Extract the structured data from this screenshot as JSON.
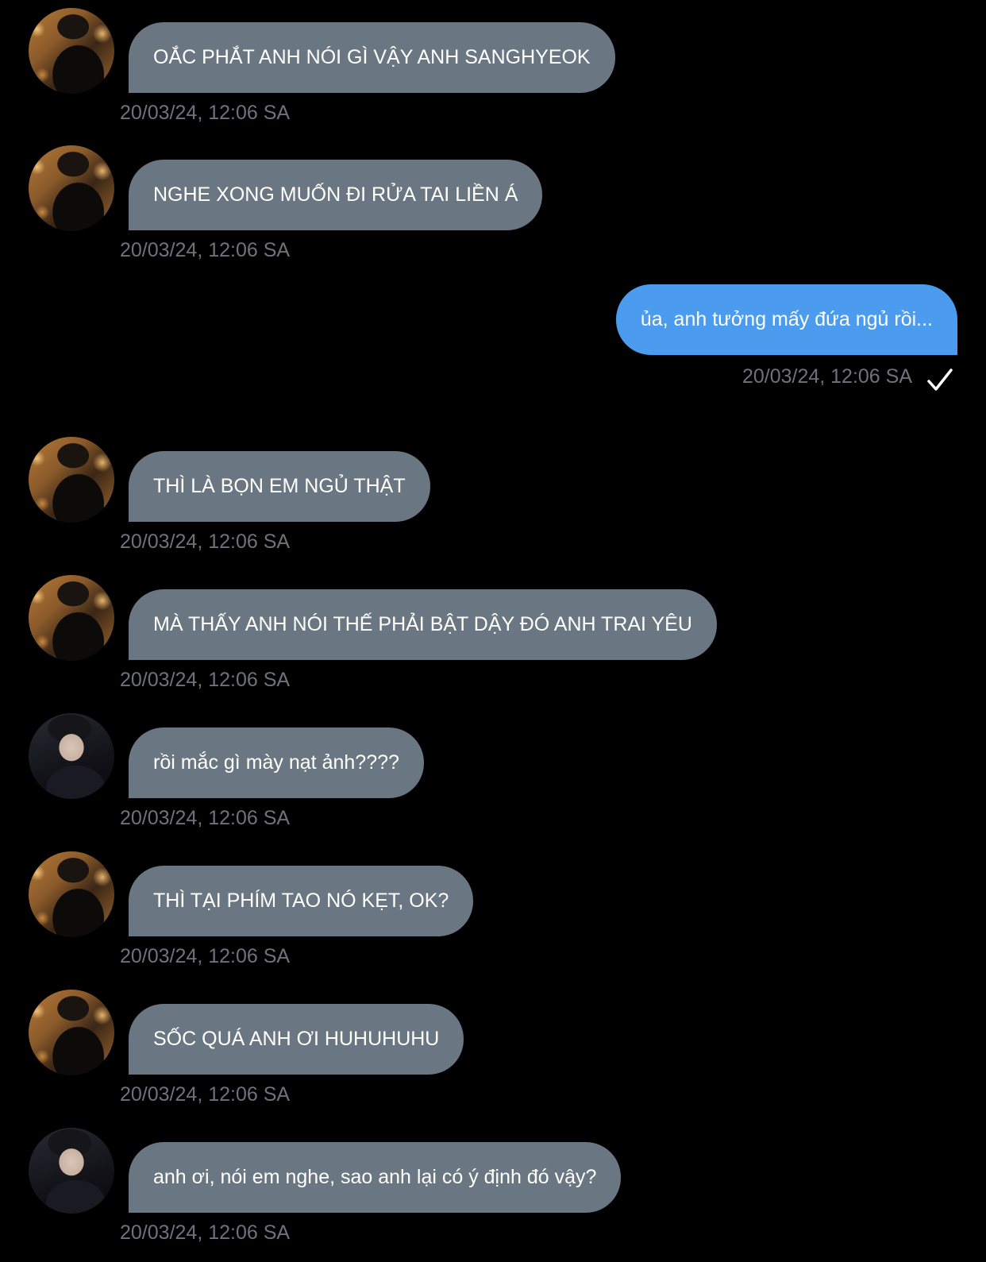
{
  "messages": [
    {
      "direction": "received",
      "avatar": "avatar-a",
      "text": "OẮC PHẮT ANH NÓI GÌ VẬY ANH SANGHYEOK",
      "time": "20/03/24, 12:06 SA"
    },
    {
      "direction": "received",
      "avatar": "avatar-a",
      "text": "NGHE XONG MUỐN ĐI RỬA TAI LIỀN Á",
      "time": "20/03/24, 12:06 SA"
    },
    {
      "direction": "sent",
      "text": "ủa, anh tưởng mấy đứa ngủ rồi...",
      "time": "20/03/24, 12:06 SA",
      "status_icon": "checkmark-icon"
    },
    {
      "direction": "received",
      "avatar": "avatar-a",
      "text": "THÌ LÀ BỌN EM NGỦ THẬT",
      "time": "20/03/24, 12:06 SA"
    },
    {
      "direction": "received",
      "avatar": "avatar-a",
      "text": "MÀ THẤY ANH NÓI THẾ PHẢI BẬT DẬY ĐÓ ANH TRAI YÊU",
      "time": "20/03/24, 12:06 SA"
    },
    {
      "direction": "received",
      "avatar": "avatar-b",
      "text": "rồi mắc gì mày nạt ảnh????",
      "time": "20/03/24, 12:06 SA"
    },
    {
      "direction": "received",
      "avatar": "avatar-a",
      "text": "THÌ TẠI PHÍM TAO NÓ KẸT, OK?",
      "time": "20/03/24, 12:06 SA"
    },
    {
      "direction": "received",
      "avatar": "avatar-a",
      "text": "SỐC QUÁ ANH ƠI HUHUHUHU",
      "time": "20/03/24, 12:06 SA"
    },
    {
      "direction": "received",
      "avatar": "avatar-b",
      "text": "anh ơi, nói em nghe, sao anh lại có ý định đó vậy?",
      "time": "20/03/24, 12:06 SA"
    }
  ],
  "colors": {
    "background": "#000000",
    "received_bubble": "#6a7782",
    "sent_bubble": "#4b9bef",
    "timestamp": "#6f7378",
    "text": "#ffffff"
  }
}
